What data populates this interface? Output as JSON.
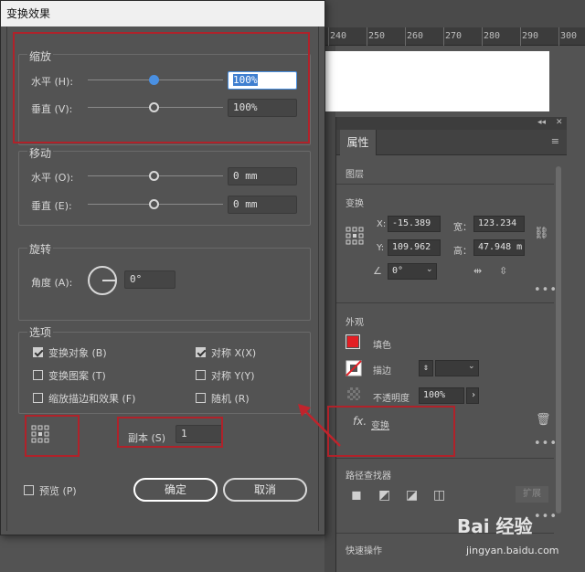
{
  "dialog": {
    "title": "变换效果",
    "scale": {
      "heading": "缩放",
      "horizontal_label": "水平 (H):",
      "horizontal_value": "100%",
      "vertical_label": "垂直 (V):",
      "vertical_value": "100%"
    },
    "move": {
      "heading": "移动",
      "horizontal_label": "水平 (O):",
      "horizontal_value": "0 mm",
      "vertical_label": "垂直 (E):",
      "vertical_value": "0 mm"
    },
    "rotate": {
      "heading": "旋转",
      "angle_label": "角度 (A):",
      "angle_value": "0°"
    },
    "options": {
      "heading": "选项",
      "transform_objects": "变换对象 (B)",
      "transform_patterns": "变换图案 (T)",
      "scale_strokes": "缩放描边和效果 (F)",
      "reflect_x": "对称 X(X)",
      "reflect_y": "对称 Y(Y)",
      "random": "随机 (R)"
    },
    "copies_label": "副本 (S)",
    "copies_value": "1",
    "preview_label": "预览 (P)",
    "ok_label": "确定",
    "cancel_label": "取消"
  },
  "ruler": {
    "ticks": [
      "240",
      "250",
      "260",
      "270",
      "280",
      "290",
      "300"
    ]
  },
  "properties": {
    "tab": "属性",
    "layer_heading": "图层",
    "transform_heading": "变换",
    "x_label": "X:",
    "x_value": "-15.389",
    "y_label": "Y:",
    "y_value": "109.962",
    "w_label": "宽：",
    "w_value": "123.234",
    "h_label": "高：",
    "h_value": "47.948 m",
    "angle_value": "0°",
    "appearance_heading": "外观",
    "fill_label": "填色",
    "stroke_label": "描边",
    "opacity_label": "不透明度",
    "opacity_value": "100%",
    "fx_label": "fx.",
    "fx_item": "变换",
    "pathfinder_heading": "路径查找器",
    "expand_label": "扩展",
    "quick_actions_heading": "快速操作",
    "fill_color": "#e31e24"
  },
  "watermark": {
    "brand": "Bai 经验",
    "url": "jingyan.baidu.com"
  }
}
